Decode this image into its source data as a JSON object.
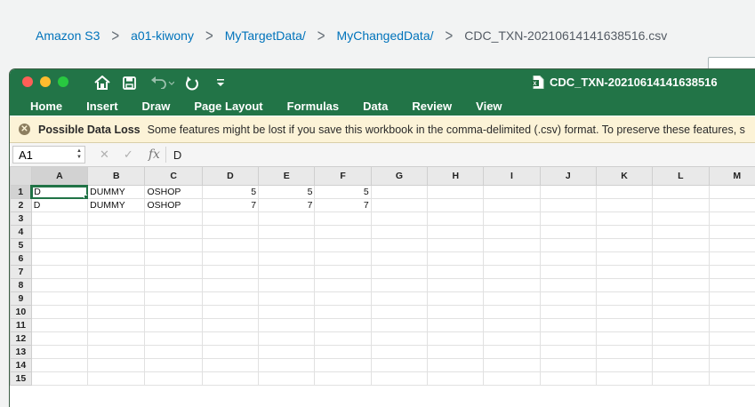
{
  "breadcrumb": {
    "items": [
      "Amazon S3",
      "a01-kiwony",
      "MyTargetData/",
      "MyChangedData/"
    ],
    "current": "CDC_TXN-20210614141638516.csv",
    "separator": ">"
  },
  "window": {
    "title": "CDC_TXN-20210614141638516",
    "quick_access_icons": [
      "home-icon",
      "save-icon",
      "undo-icon",
      "redo-icon",
      "customize-toolbar-icon"
    ]
  },
  "ribbon": {
    "tabs": [
      "Home",
      "Insert",
      "Draw",
      "Page Layout",
      "Formulas",
      "Data",
      "Review",
      "View"
    ]
  },
  "warning": {
    "title": "Possible Data Loss",
    "message": "Some features might be lost if you save this workbook in the comma-delimited (.csv) format. To preserve these features, s"
  },
  "formula_bar": {
    "name_box": "A1",
    "fx_label": "fx",
    "value": "D"
  },
  "sheet": {
    "columns": [
      "A",
      "B",
      "C",
      "D",
      "E",
      "F",
      "G",
      "H",
      "I",
      "J",
      "K",
      "L",
      "M"
    ],
    "rows": [
      "1",
      "2",
      "3",
      "4",
      "5",
      "6",
      "7",
      "8",
      "9",
      "10",
      "11",
      "12",
      "13",
      "14",
      "15"
    ],
    "cells": [
      [
        "D",
        "DUMMY",
        "OSHOP",
        "5",
        "5",
        "5"
      ],
      [
        "D",
        "DUMMY",
        "OSHOP",
        "7",
        "7",
        "7"
      ]
    ],
    "active_cell": "A1"
  },
  "colors": {
    "excel_green": "#227447",
    "aws_link": "#0073bb",
    "warning_bg": "#fcf3d7"
  }
}
